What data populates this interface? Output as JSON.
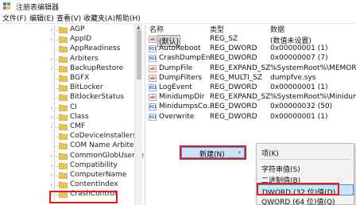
{
  "window": {
    "title": "注册表编辑器"
  },
  "menubar": {
    "items": [
      "文件(F)",
      "编辑(E)",
      "查看(V)",
      "收藏夹(A)",
      "帮助(H)"
    ]
  },
  "tree": {
    "items": [
      {
        "label": "AGP",
        "expandable": true
      },
      {
        "label": "AppID",
        "expandable": true
      },
      {
        "label": "AppReadiness",
        "expandable": false
      },
      {
        "label": "Arbiters",
        "expandable": true
      },
      {
        "label": "BackupRestore",
        "expandable": true
      },
      {
        "label": "BGFX",
        "expandable": false
      },
      {
        "label": "BitLocker",
        "expandable": false
      },
      {
        "label": "BitlockerStatus",
        "expandable": false
      },
      {
        "label": "CI",
        "expandable": true
      },
      {
        "label": "Class",
        "expandable": true
      },
      {
        "label": "CMF",
        "expandable": true
      },
      {
        "label": "CoDeviceInstallers",
        "expandable": false
      },
      {
        "label": "COM Name Arbiter",
        "expandable": false
      },
      {
        "label": "CommonGlobUserSetti",
        "expandable": true
      },
      {
        "label": "Compatibility",
        "expandable": true
      },
      {
        "label": "ComputerName",
        "expandable": true
      },
      {
        "label": "ContentIndex",
        "expandable": true
      },
      {
        "label": "CrashControl",
        "expandable": true,
        "selected": true
      }
    ]
  },
  "values": {
    "headers": {
      "name": "名称",
      "type": "类型",
      "data": "数据"
    },
    "rows": [
      {
        "icon": "ab",
        "kind": "sz",
        "name": "(默认)",
        "type": "REG_SZ",
        "data": "(数值未设置)",
        "selected": true
      },
      {
        "icon": "011",
        "kind": "dw",
        "name": "AutoReboot",
        "type": "REG_DWORD",
        "data": "0x00000001 (1)"
      },
      {
        "icon": "011",
        "kind": "dw",
        "name": "CrashDumpEn...",
        "type": "REG_DWORD",
        "data": "0x00000007 (7)"
      },
      {
        "icon": "ab",
        "kind": "sz",
        "name": "DumpFile",
        "type": "REG_EXPAND_SZ",
        "data": "%SystemRoot%\\MEMORY.DM"
      },
      {
        "icon": "ab",
        "kind": "sz",
        "name": "DumpFilters",
        "type": "REG_MULTI_SZ",
        "data": "dumpfve.sys"
      },
      {
        "icon": "011",
        "kind": "dw",
        "name": "LogEvent",
        "type": "REG_DWORD",
        "data": "0x00000001 (1)"
      },
      {
        "icon": "ab",
        "kind": "sz",
        "name": "MinidumpDir",
        "type": "REG_EXPAND_SZ",
        "data": "%SystemRoot%\\Minidump"
      },
      {
        "icon": "011",
        "kind": "dw",
        "name": "MinidumpsCo...",
        "type": "REG_DWORD",
        "data": "0x00000032 (50)"
      },
      {
        "icon": "011",
        "kind": "dw",
        "name": "Overwrite",
        "type": "REG_DWORD",
        "data": "0x00000001 (1)"
      }
    ]
  },
  "context_menu": {
    "new_label": "新建(N)",
    "arrow": "›"
  },
  "submenu": {
    "items": [
      "项(K)",
      "字符串值(S)",
      "二进制值(B)",
      "DWORD (32 位)值(D)",
      "QWORD (64 位)值(Q)"
    ]
  },
  "colors": {
    "highlight": "#e02020",
    "menu_hover": "#cce4f7",
    "folder": "#e8c35a"
  }
}
